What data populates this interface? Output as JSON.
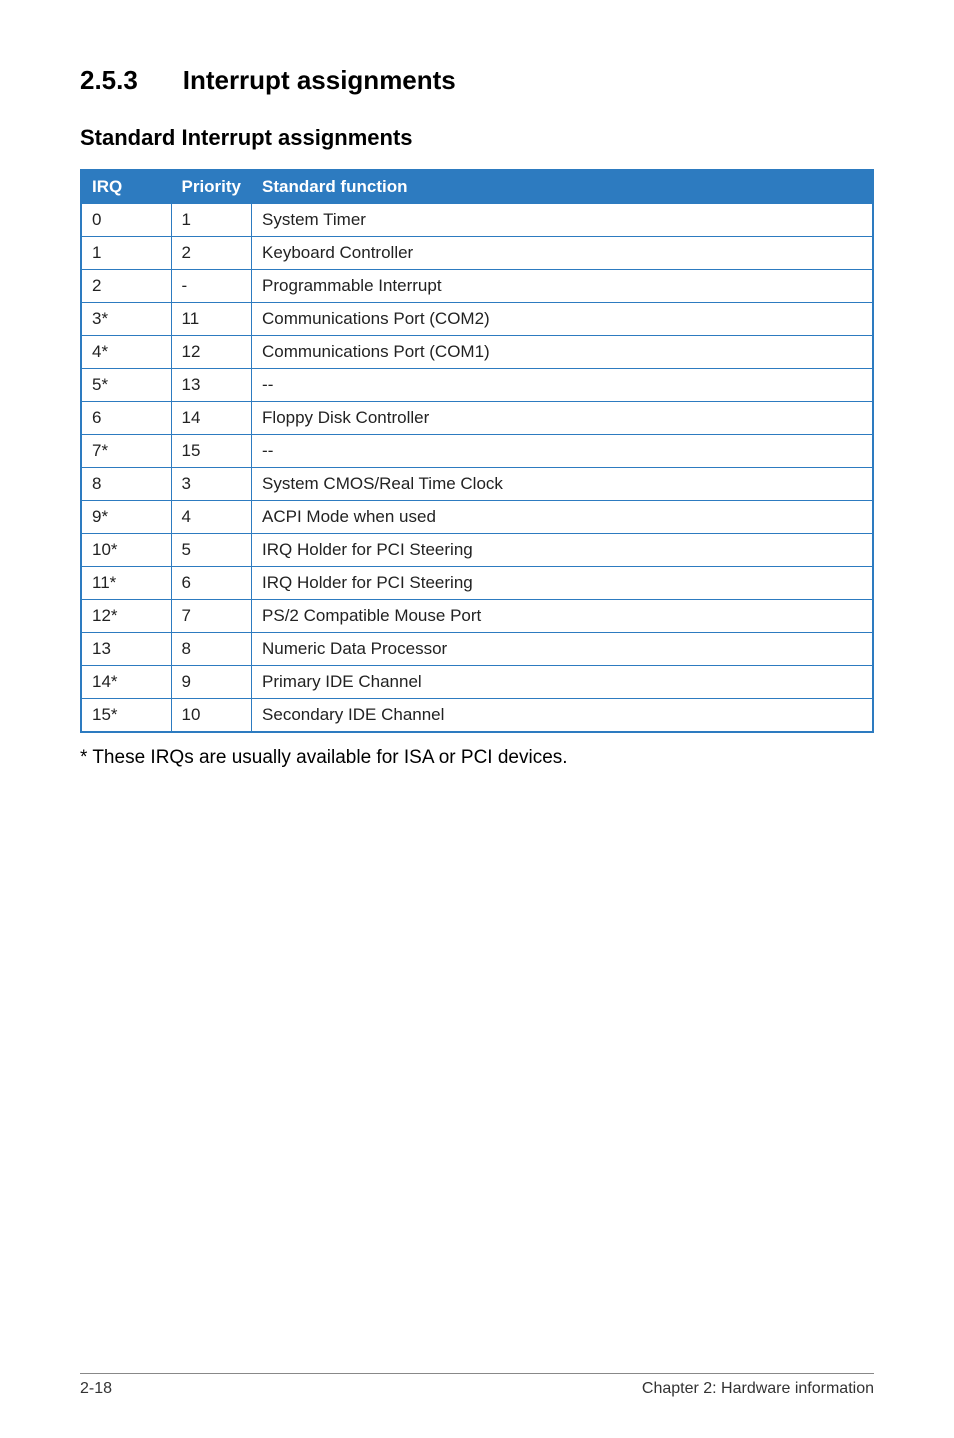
{
  "section": {
    "number": "2.5.3",
    "title": "Interrupt assignments"
  },
  "subheading": "Standard Interrupt assignments",
  "headers": {
    "irq": "IRQ",
    "priority": "Priority",
    "func": "Standard function"
  },
  "rows": [
    {
      "irq": "0",
      "priority": "1",
      "func": "System Timer"
    },
    {
      "irq": "1",
      "priority": "2",
      "func": "Keyboard Controller"
    },
    {
      "irq": "2",
      "priority": "-",
      "func": "Programmable Interrupt"
    },
    {
      "irq": "3*",
      "priority": "11",
      "func": "Communications Port (COM2)"
    },
    {
      "irq": "4*",
      "priority": "12",
      "func": "Communications Port (COM1)"
    },
    {
      "irq": "5*",
      "priority": "13",
      "func": "--"
    },
    {
      "irq": "6",
      "priority": "14",
      "func": "Floppy Disk Controller"
    },
    {
      "irq": "7*",
      "priority": "15",
      "func": "--"
    },
    {
      "irq": "8",
      "priority": "3",
      "func": "System CMOS/Real Time Clock"
    },
    {
      "irq": "9*",
      "priority": "4",
      "func": "ACPI Mode when used"
    },
    {
      "irq": "10*",
      "priority": "5",
      "func": "IRQ Holder for PCI Steering"
    },
    {
      "irq": "11*",
      "priority": "6",
      "func": "IRQ Holder for PCI Steering"
    },
    {
      "irq": "12*",
      "priority": "7",
      "func": "PS/2 Compatible Mouse Port"
    },
    {
      "irq": "13",
      "priority": "8",
      "func": "Numeric Data Processor"
    },
    {
      "irq": "14*",
      "priority": "9",
      "func": "Primary IDE Channel"
    },
    {
      "irq": "15*",
      "priority": "10",
      "func": "Secondary IDE Channel"
    }
  ],
  "footnote": "* These IRQs are usually available for ISA or PCI devices.",
  "footer": {
    "left": "2-18",
    "right": "Chapter 2: Hardware information"
  }
}
